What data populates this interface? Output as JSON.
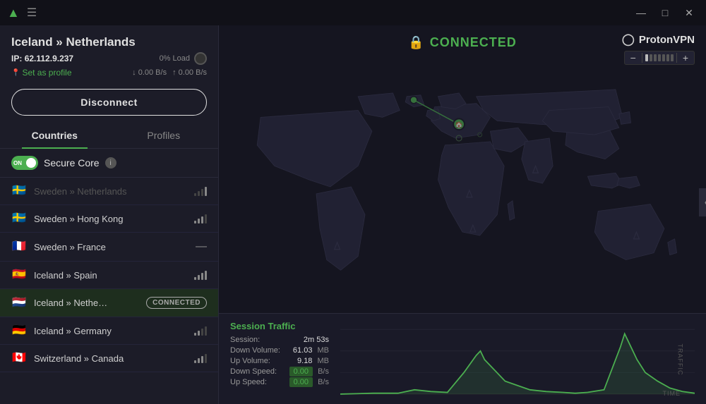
{
  "titlebar": {
    "minimize_label": "—",
    "maximize_label": "□",
    "close_label": "✕",
    "menu_label": "☰"
  },
  "connection": {
    "title": "Iceland » Netherlands",
    "ip_label": "IP:",
    "ip_address": "62.112.9.237",
    "load_label": "0% Load",
    "set_profile": "Set as profile",
    "speed_down": "0.00 B/s",
    "speed_up": "0.00 B/s",
    "disconnect_label": "Disconnect",
    "status": "CONNECTED"
  },
  "tabs": {
    "countries": "Countries",
    "profiles": "Profiles"
  },
  "secure_core": {
    "label": "Secure Core",
    "toggle_state": "ON"
  },
  "servers": [
    {
      "id": "sweden-hk",
      "flag": "🇸🇪",
      "name": "Sweden » Hong Kong",
      "connected": false,
      "dimmed": false
    },
    {
      "id": "sweden-fr",
      "flag": "🇫🇷",
      "name": "Sweden » France",
      "connected": false,
      "dimmed": false,
      "has_minus": true
    },
    {
      "id": "iceland-es",
      "flag": "🇪🇸",
      "name": "Iceland » Spain",
      "connected": false,
      "dimmed": false
    },
    {
      "id": "iceland-nl",
      "flag": "🇳🇱",
      "name": "Iceland » Nethe…",
      "connected": true,
      "dimmed": false
    },
    {
      "id": "iceland-de",
      "flag": "🇩🇪",
      "name": "Iceland » Germany",
      "connected": false,
      "dimmed": false
    },
    {
      "id": "ch-ca",
      "flag": "🇨🇦",
      "name": "Switzerland » Canada",
      "connected": false,
      "dimmed": false
    }
  ],
  "proton": {
    "logo_icon": "⬡",
    "title": "ProtonVPN",
    "zoom_minus": "−",
    "zoom_plus": "+"
  },
  "traffic": {
    "section_title": "Session Traffic",
    "rows": [
      {
        "label": "Session:",
        "value": "2m 53s",
        "unit": ""
      },
      {
        "label": "Down Volume:",
        "value": "61.03",
        "unit": "MB"
      },
      {
        "label": "Up Volume:",
        "value": "9.18",
        "unit": "MB"
      },
      {
        "label": "Down Speed:",
        "value": "0.00",
        "unit": "B/s",
        "is_speed": true
      },
      {
        "label": "Up Speed:",
        "value": "0.00",
        "unit": "B/s",
        "is_speed": true
      }
    ]
  },
  "chart": {
    "traffic_axis": "TRAFFIC",
    "time_axis": "TIME"
  }
}
